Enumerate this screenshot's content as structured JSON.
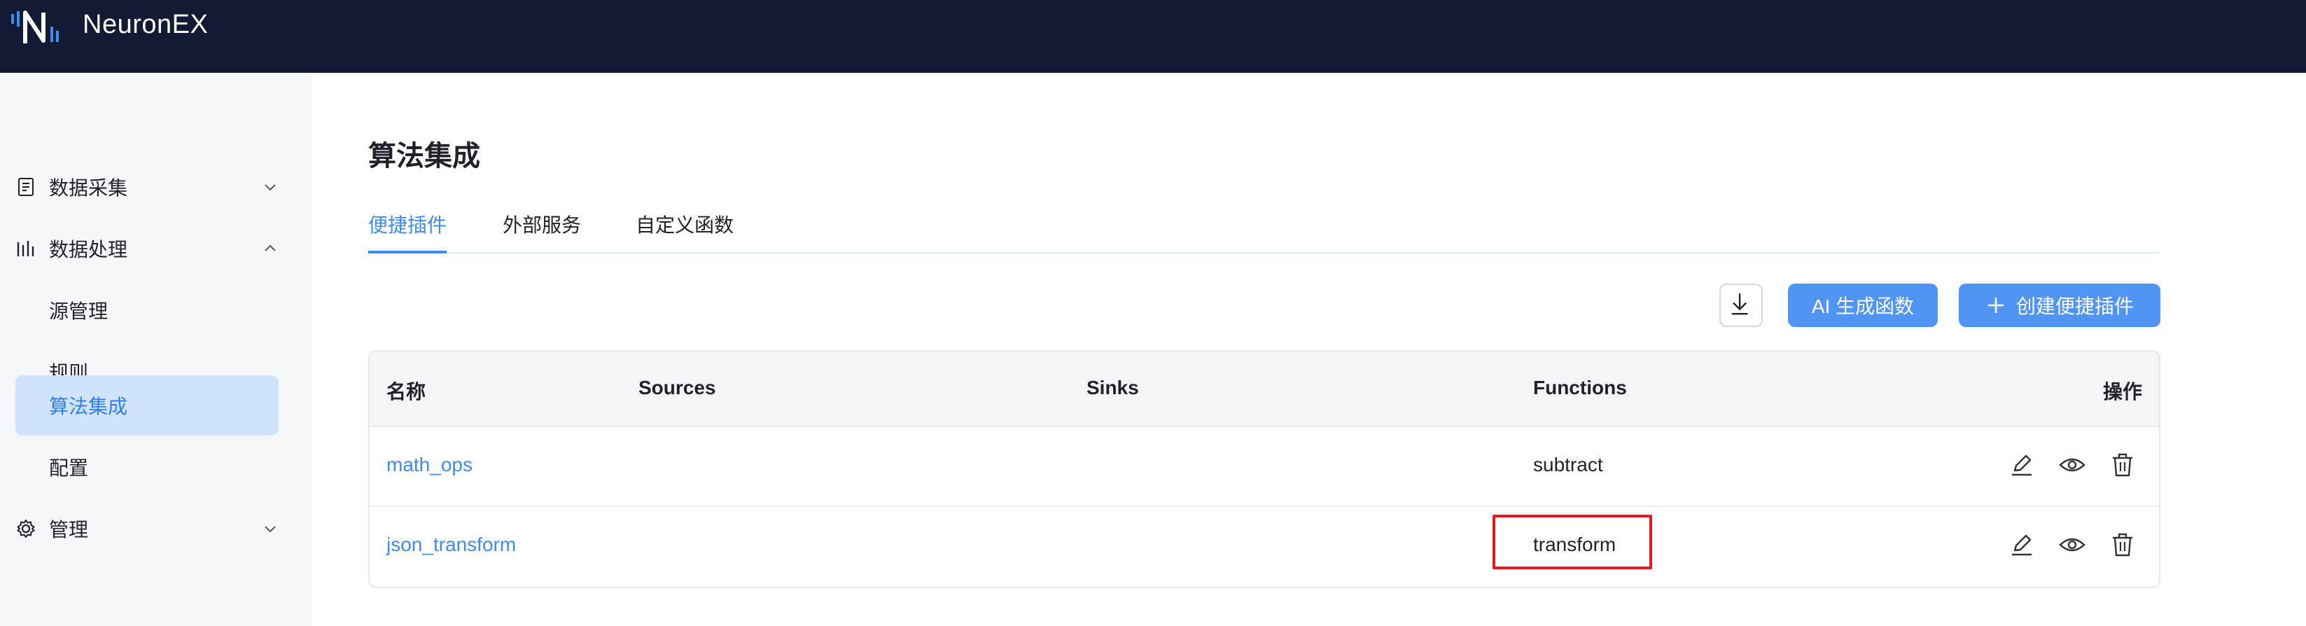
{
  "app": {
    "brand": "NeuronEX",
    "logo_icon": "neuronex-logo"
  },
  "colors": {
    "topbar": "#131a34",
    "accent": "#3d8cf0",
    "button": "#5095f4",
    "active_menu_bg": "#cfe3fc",
    "highlight": "#e5191d"
  },
  "sidebar": {
    "items": [
      {
        "label": "数据采集",
        "icon": "data-collection-icon",
        "expanded": false
      },
      {
        "label": "数据处理",
        "icon": "data-processing-icon",
        "expanded": true,
        "children": [
          {
            "label": "源管理"
          },
          {
            "label": "规则"
          },
          {
            "label": "算法集成",
            "active": true
          },
          {
            "label": "配置"
          }
        ]
      },
      {
        "label": "管理",
        "icon": "gear-icon",
        "expanded": false
      }
    ]
  },
  "page": {
    "title": "算法集成",
    "tabs": [
      {
        "label": "便捷插件",
        "active": true
      },
      {
        "label": "外部服务"
      },
      {
        "label": "自定义函数"
      }
    ],
    "toolbar": {
      "download_icon": "download-icon",
      "ai_button": "AI 生成函数",
      "create_button": "创建便捷插件"
    },
    "table": {
      "columns": [
        "名称",
        "Sources",
        "Sinks",
        "Functions",
        "操作"
      ],
      "rows": [
        {
          "name": "math_ops",
          "sources": "",
          "sinks": "",
          "functions": "subtract"
        },
        {
          "name": "json_transform",
          "sources": "",
          "sinks": "",
          "functions": "transform"
        }
      ],
      "action_icons": [
        "edit-icon",
        "eye-icon",
        "trash-icon"
      ]
    }
  }
}
